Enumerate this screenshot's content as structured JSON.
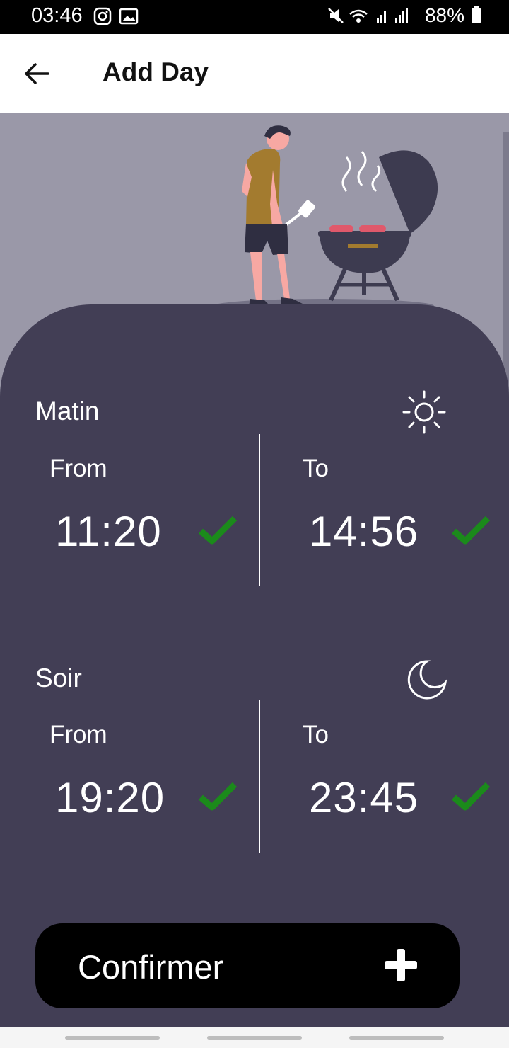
{
  "status": {
    "time": "03:46",
    "battery": "88%"
  },
  "header": {
    "title": "Add Day"
  },
  "morning": {
    "label": "Matin",
    "from_label": "From",
    "from_value": "11:20",
    "to_label": "To",
    "to_value": "14:56",
    "icon": "sun-icon"
  },
  "evening": {
    "label": "Soir",
    "from_label": "From",
    "from_value": "19:20",
    "to_label": "To",
    "to_value": "23:45",
    "icon": "moon-icon"
  },
  "confirm": {
    "label": "Confirmer",
    "icon": "plus-icon"
  },
  "colors": {
    "card": "#423e55",
    "background": "#9a98a8",
    "check": "#1b8a1b",
    "button": "#000000"
  }
}
